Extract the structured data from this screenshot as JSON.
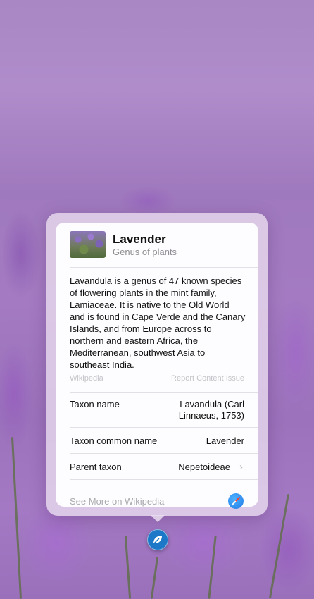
{
  "card": {
    "title": "Lavender",
    "subtitle": "Genus of plants",
    "thumbnail_icon": "lavender-thumbnail",
    "description": "Lavandula is a genus of 47 known species of flowering plants in the mint family, Lamiaceae. It is native to the Old World and is found in Cape Verde and the Canary Islands, and from Europe across to northern and eastern Africa, the Mediterranean, southwest Asia to southeast India.",
    "source": "Wikipedia",
    "report_label": "Report Content Issue",
    "rows": [
      {
        "label": "Taxon name",
        "value_line1": "Lavandula (Carl",
        "value_line2": "Linnaeus, 1753)"
      },
      {
        "label": "Taxon common name",
        "value": "Lavender"
      },
      {
        "label": "Parent taxon",
        "value": "Nepetoideae",
        "icon": "chevron-right-icon"
      }
    ],
    "see_more": "See More on Wikipedia",
    "see_more_icon": "safari-compass-icon"
  },
  "visual_lookup_button": {
    "icon": "leaf-icon",
    "color": "#1e78c8"
  }
}
